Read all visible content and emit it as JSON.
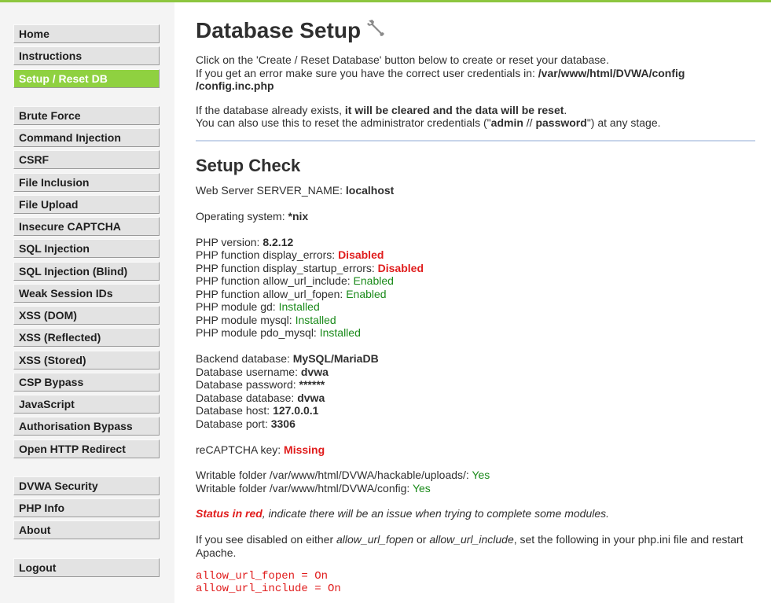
{
  "sidebar": {
    "group1": [
      "Home",
      "Instructions",
      "Setup / Reset DB"
    ],
    "group2": [
      "Brute Force",
      "Command Injection",
      "CSRF",
      "File Inclusion",
      "File Upload",
      "Insecure CAPTCHA",
      "SQL Injection",
      "SQL Injection (Blind)",
      "Weak Session IDs",
      "XSS (DOM)",
      "XSS (Reflected)",
      "XSS (Stored)",
      "CSP Bypass",
      "JavaScript",
      "Authorisation Bypass",
      "Open HTTP Redirect"
    ],
    "group3": [
      "DVWA Security",
      "PHP Info",
      "About"
    ],
    "group4": [
      "Logout"
    ]
  },
  "page": {
    "title": "Database Setup",
    "intro1": "Click on the 'Create / Reset Database' button below to create or reset your database.",
    "intro2_pre": "If you get an error make sure you have the correct user credentials in: ",
    "intro2_path1": "/var/www/html/DVWA/config",
    "intro2_path2": "/config.inc.php",
    "exists_pre": "If the database already exists, ",
    "exists_bold": "it will be cleared and the data will be reset",
    "exists_post": ".",
    "reset_pre": "You can also use this to reset the administrator credentials (\"",
    "reset_admin": "admin",
    "reset_sep": " // ",
    "reset_password": "password",
    "reset_post": "\") at any stage."
  },
  "check": {
    "heading": "Setup Check",
    "server_label": "Web Server SERVER_NAME: ",
    "server_value": "localhost",
    "os_label": "Operating system: ",
    "os_value": "*nix",
    "php_version_label": "PHP version: ",
    "php_version_value": "8.2.12",
    "display_errors_label": "PHP function display_errors: ",
    "display_errors_value": "Disabled",
    "display_startup_label": "PHP function display_startup_errors: ",
    "display_startup_value": "Disabled",
    "allow_include_label": "PHP function allow_url_include: ",
    "allow_include_value": "Enabled",
    "allow_fopen_label": "PHP function allow_url_fopen: ",
    "allow_fopen_value": "Enabled",
    "gd_label": "PHP module gd: ",
    "gd_value": "Installed",
    "mysql_label": "PHP module mysql: ",
    "mysql_value": "Installed",
    "pdo_label": "PHP module pdo_mysql: ",
    "pdo_value": "Installed",
    "backend_label": "Backend database: ",
    "backend_value": "MySQL/MariaDB",
    "db_user_label": "Database username: ",
    "db_user_value": "dvwa",
    "db_pass_label": "Database password: ",
    "db_pass_value": "******",
    "db_name_label": "Database database: ",
    "db_name_value": "dvwa",
    "db_host_label": "Database host: ",
    "db_host_value": "127.0.0.1",
    "db_port_label": "Database port: ",
    "db_port_value": "3306",
    "recaptcha_label": "reCAPTCHA key: ",
    "recaptcha_value": "Missing",
    "upload_folder_label": "Writable folder /var/www/html/DVWA/hackable/uploads/: ",
    "upload_folder_value": "Yes",
    "config_folder_label": "Writable folder /var/www/html/DVWA/config: ",
    "config_folder_value": "Yes",
    "status_red": "Status in red",
    "status_rest": ", indicate there will be an issue when trying to complete some modules.",
    "disabled_pre": "If you see disabled on either ",
    "disabled_fopen": "allow_url_fopen",
    "disabled_or": " or ",
    "disabled_include": "allow_url_include",
    "disabled_post": ", set the following in your php.ini file and restart Apache.",
    "code1": "allow_url_fopen = On",
    "code2": "allow_url_include = On"
  },
  "colors": {
    "accent": "#8dc63f",
    "ok": "#1a8a1a",
    "error": "#e01c1c"
  },
  "icons": {
    "title_icon": "wrench-icon"
  }
}
